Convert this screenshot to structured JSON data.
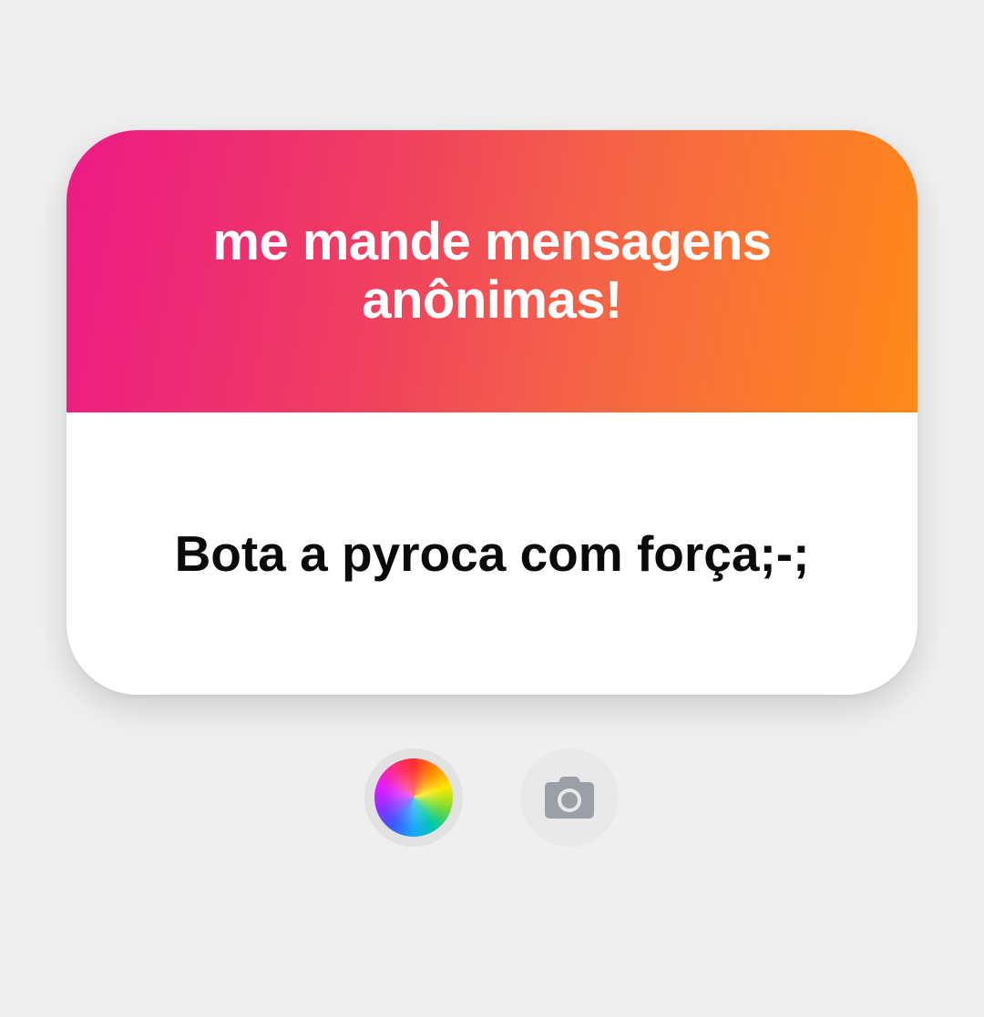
{
  "question_card": {
    "prompt": "me mande mensagens anônimas!",
    "response": "Bota a pyroca com força;-;"
  },
  "controls": {
    "color_picker_icon": "color-wheel-icon",
    "camera_icon": "camera-icon"
  },
  "colors": {
    "gradient_start": "#ec1a86",
    "gradient_end": "#ff8a17",
    "background": "#efefef",
    "card_body": "#ffffff",
    "text_on_gradient": "#ffffff",
    "response_text": "#0a0a0a",
    "camera_icon": "#9aa0a6"
  }
}
